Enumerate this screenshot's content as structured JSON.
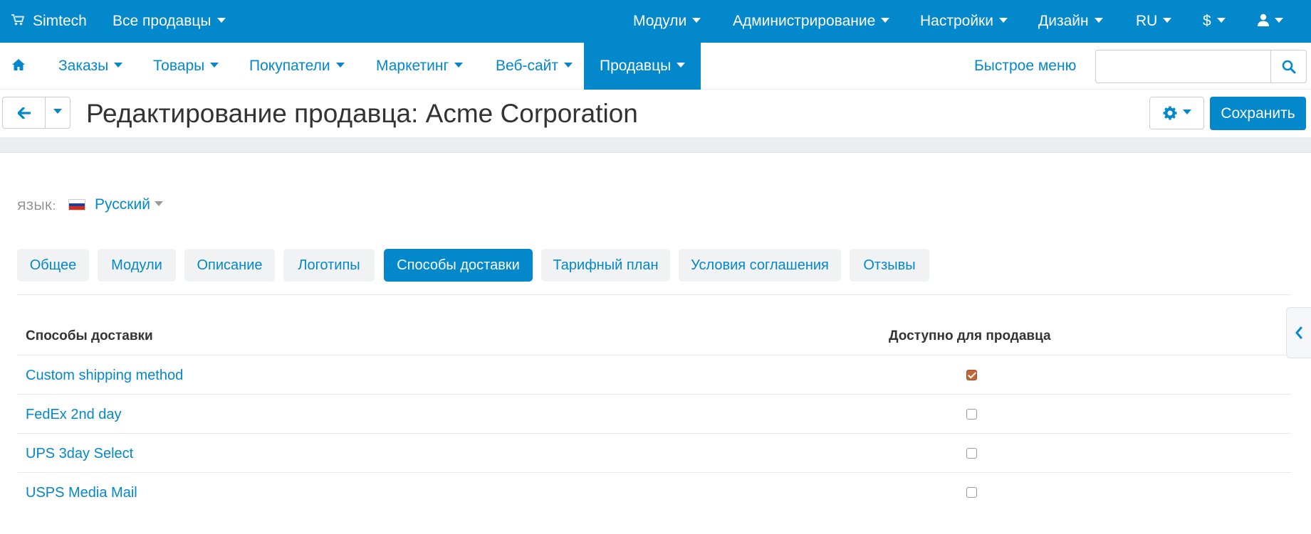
{
  "topbar": {
    "brand": "Simtech",
    "vendors_dropdown": "Все продавцы",
    "menu": [
      {
        "label": "Модули"
      },
      {
        "label": "Администрирование"
      },
      {
        "label": "Настройки"
      },
      {
        "label": "Дизайн"
      },
      {
        "label": "RU"
      },
      {
        "label": "$"
      }
    ],
    "colors": {
      "bar": "#0388cc"
    }
  },
  "mainnav": {
    "items": [
      {
        "label": "Заказы"
      },
      {
        "label": "Товары"
      },
      {
        "label": "Покупатели"
      },
      {
        "label": "Маркетинг"
      },
      {
        "label": "Веб-сайт"
      },
      {
        "label": "Продавцы"
      }
    ],
    "active_item": "Продавцы",
    "quick_menu": "Быстрое меню",
    "search": {
      "value": "",
      "placeholder": ""
    }
  },
  "titlebar": {
    "title": "Редактирование продавца: Acme Corporation",
    "save_label": "Сохранить"
  },
  "language": {
    "label": "ЯЗЫК:",
    "selected": "Русский",
    "flag_colors": [
      "#ffffff",
      "#1c3f99",
      "#d52b1e"
    ]
  },
  "tabs": [
    {
      "label": "Общее"
    },
    {
      "label": "Модули"
    },
    {
      "label": "Описание"
    },
    {
      "label": "Логотипы"
    },
    {
      "label": "Способы доставки"
    },
    {
      "label": "Тарифный план"
    },
    {
      "label": "Условия соглашения"
    },
    {
      "label": "Отзывы"
    }
  ],
  "active_tab": "Способы доставки",
  "table": {
    "headers": [
      "Способы доставки",
      "Доступно для продавца"
    ],
    "rows": [
      {
        "name": "Custom shipping method",
        "available": true
      },
      {
        "name": "FedEx 2nd day",
        "available": false
      },
      {
        "name": "UPS 3day Select",
        "available": false
      },
      {
        "name": "USPS Media Mail",
        "available": false
      }
    ]
  }
}
